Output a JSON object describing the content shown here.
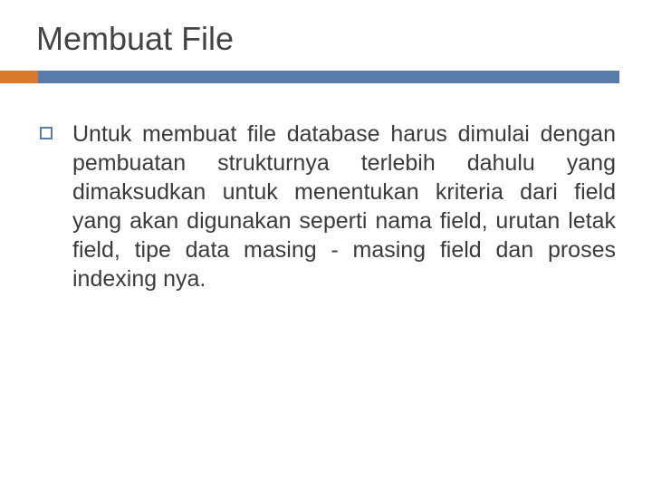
{
  "title": "Membuat File",
  "bullets": [
    "Untuk membuat file database harus dimulai dengan pembuatan strukturnya terlebih dahulu yang dimaksudkan untuk menentukan kriteria dari field yang akan digunakan seperti nama field, urutan letak field, tipe data masing - masing field dan proses indexing nya."
  ],
  "colors": {
    "accent_orange": "#d8792b",
    "accent_blue": "#5a7cab"
  }
}
